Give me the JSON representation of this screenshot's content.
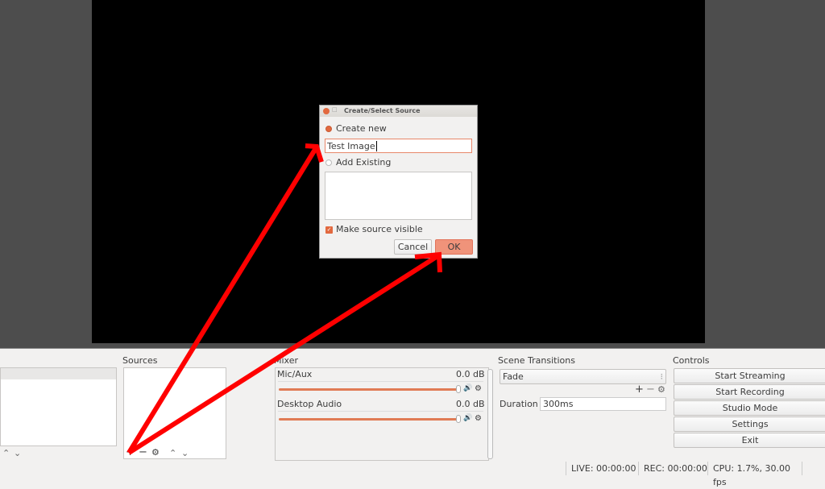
{
  "dialog": {
    "title": "Create/Select Source",
    "create_new": "Create new",
    "name_value": "Test Image",
    "add_existing": "Add Existing",
    "make_visible": "Make source visible",
    "make_visible_checked": true,
    "cancel": "Cancel",
    "ok": "OK"
  },
  "sources": {
    "title": "Sources"
  },
  "mixer": {
    "title": "Mixer",
    "channels": [
      {
        "name": "Mic/Aux",
        "level": "0.0 dB",
        "volume": 1.0
      },
      {
        "name": "Desktop Audio",
        "level": "0.0 dB",
        "volume": 1.0
      }
    ]
  },
  "transitions": {
    "title": "Scene Transitions",
    "selected": "Fade",
    "duration_label": "Duration",
    "duration_value": "300ms"
  },
  "controls": {
    "title": "Controls",
    "buttons": [
      "Start Streaming",
      "Start Recording",
      "Studio Mode",
      "Settings",
      "Exit"
    ]
  },
  "status": {
    "live": "LIVE: 00:00:00",
    "rec": "REC: 00:00:00",
    "cpu": "CPU: 1.7%, 30.00 fps"
  },
  "annotation": {
    "color": "#ff0000"
  }
}
